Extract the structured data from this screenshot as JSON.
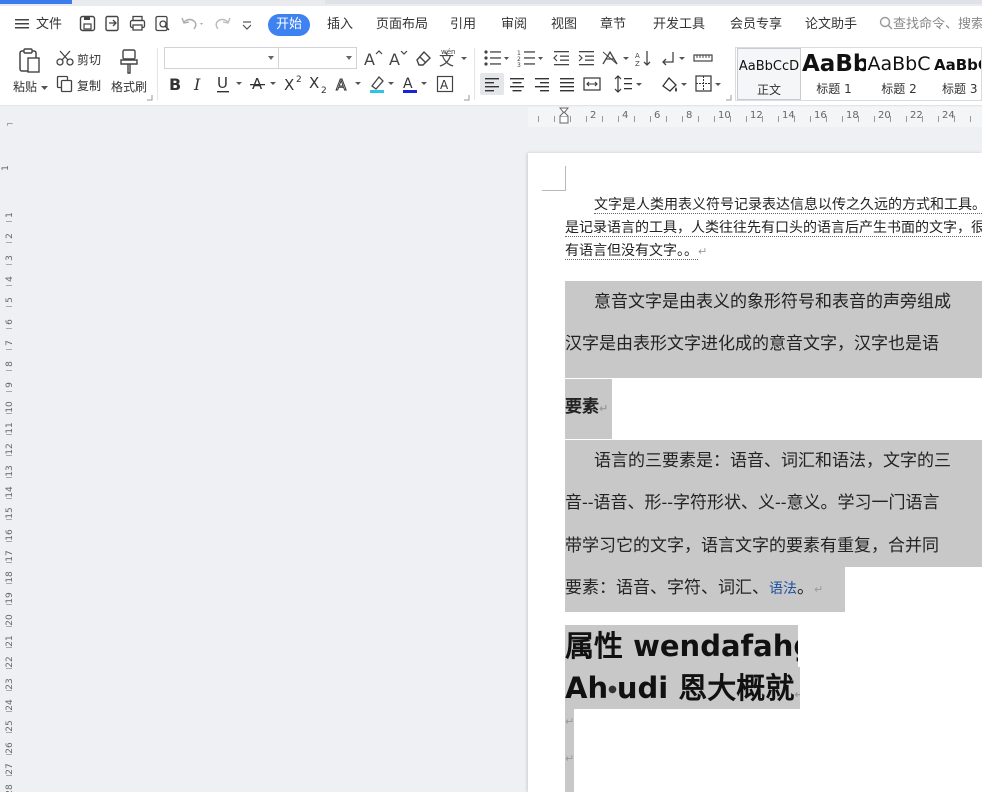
{
  "menubar": {
    "file_label": "文件",
    "tabs": [
      "开始",
      "插入",
      "页面布局",
      "引用",
      "审阅",
      "视图",
      "章节",
      "开发工具",
      "会员专享",
      "论文助手"
    ],
    "search_placeholder": "查找命令、搜索"
  },
  "toolbar": {
    "paste": "粘贴",
    "cut": "剪切",
    "copy": "复制",
    "format_painter": "格式刷",
    "font_name": "",
    "font_size": ""
  },
  "styles": [
    {
      "preview": "AaBbCcD",
      "name": "正文",
      "selected": true
    },
    {
      "preview": "AaBb",
      "name": "标题 1",
      "selected": false
    },
    {
      "preview": "AaBbC",
      "name": "标题 2",
      "selected": false
    },
    {
      "preview": "AaBbC",
      "name": "标题 3",
      "selected": false
    }
  ],
  "ruler": {
    "h_numbers": [
      "2",
      "4",
      "6",
      "8",
      "10",
      "12",
      "14",
      "16",
      "18",
      "20",
      "22",
      "24"
    ],
    "v_numbers": [
      "1",
      "2",
      "3",
      "4",
      "5",
      "6",
      "7",
      "8",
      "9",
      "10",
      "11",
      "12",
      "13",
      "14",
      "15",
      "16",
      "17",
      "18",
      "19",
      "20",
      "21",
      "22",
      "23",
      "24",
      "25",
      "26",
      "27",
      "28"
    ],
    "v_top_mark": "1"
  },
  "document": {
    "p1_lines": [
      "文字是人类用表义符号记录表达信息以传之久远的方式和工具。",
      "是记录语言的工具，人类往往先有口头的语言后产生书面的文字，很",
      "有语言但没有文字。。"
    ],
    "p2_line1": "意音文字是由表义的象形符号和表音的声旁组成",
    "p2_line2": "汉字是由表形文字进化成的意音文字，汉字也是语",
    "p3": "要素",
    "p4_line1": "语言的三要素是：语音、词汇和语法，文字的三",
    "p4_line2": "音--语音、形--字符形状、义--意义。学习一门语言",
    "p4_line3": "带学习它的文字，语言文字的要素有重复，合并同",
    "p4_line4_a": "要素：语音、字符、词汇、",
    "p4_line4_link": "语法",
    "p4_line4_b": "。",
    "h1": "属性 wendafahg",
    "h2_a": "Ah",
    "h2_b": "udi 恩大概就"
  },
  "colors": {
    "accent": "#3d82f0",
    "highlight": "#c8c8c8"
  }
}
